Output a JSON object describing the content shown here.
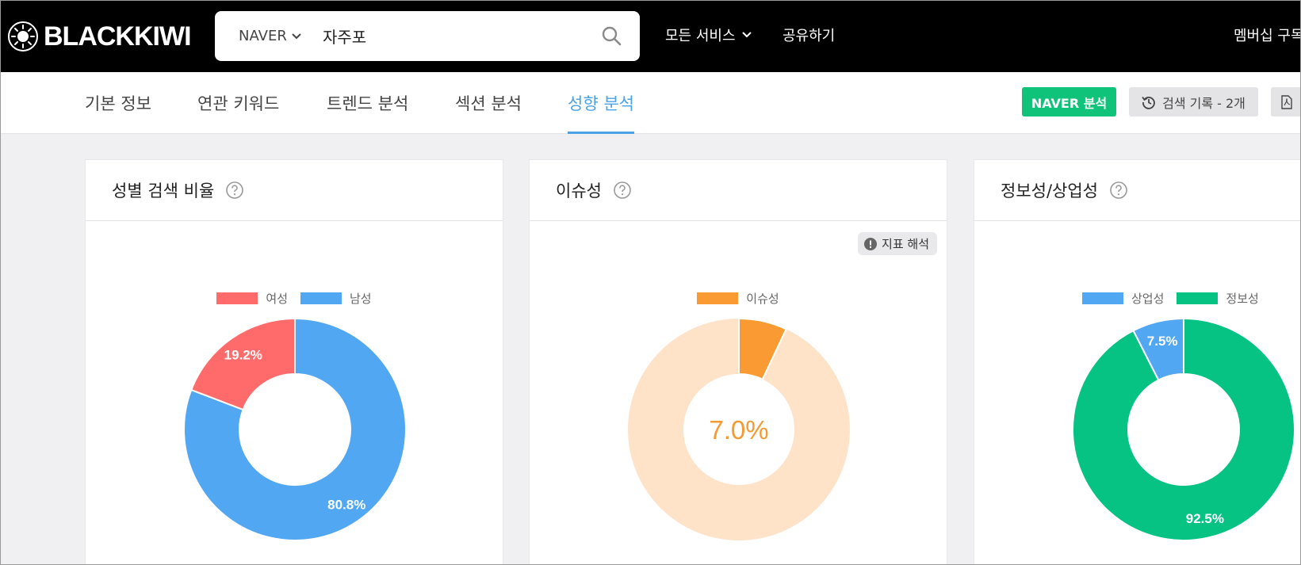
{
  "header": {
    "brand": "BLACKKIWI",
    "search": {
      "engine": "NAVER",
      "query": "자주포"
    },
    "nav": {
      "all_services": "모든 서비스",
      "share": "공유하기",
      "membership": "멤버십 구독"
    }
  },
  "tabs": [
    {
      "label": "기본 정보",
      "active": false
    },
    {
      "label": "연관 키워드",
      "active": false
    },
    {
      "label": "트렌드 분석",
      "active": false
    },
    {
      "label": "섹션 분석",
      "active": false
    },
    {
      "label": "성향 분석",
      "active": true
    }
  ],
  "actions": {
    "naver_label": "NAVER 분석",
    "history_label": "검색 기록 - 2개"
  },
  "colors": {
    "female": "#ff6b6b",
    "male": "#52a7f2",
    "issue": "#f99b32",
    "issue_bg": "#fee3c9",
    "commercial": "#52a7f2",
    "informational": "#06c383",
    "active_tab": "#4aa3e6",
    "naver_green": "#0fc37a"
  },
  "cards": [
    {
      "title": "성별 검색 비율"
    },
    {
      "title": "이슈성",
      "badge": "지표 해석"
    },
    {
      "title": "정보성/상업성"
    }
  ],
  "chart_data": [
    {
      "type": "pie",
      "legend_position": "top",
      "labels": [
        "여성",
        "남성"
      ],
      "values": [
        19.2,
        80.8
      ],
      "value_labels": [
        "19.2%",
        "80.8%"
      ]
    },
    {
      "type": "pie",
      "legend_position": "top",
      "labels": [
        "이슈성"
      ],
      "values": [
        7.0
      ],
      "center_label": "7.0%"
    },
    {
      "type": "pie",
      "legend_position": "top",
      "labels": [
        "상업성",
        "정보성"
      ],
      "values": [
        7.5,
        92.5
      ],
      "value_labels": [
        "7.5%",
        "92.5%"
      ]
    }
  ]
}
